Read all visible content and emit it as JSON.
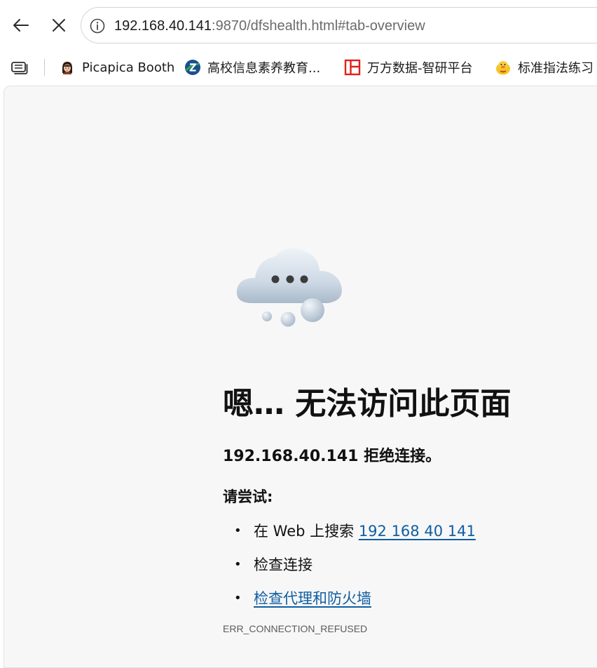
{
  "toolbar": {
    "back_icon": "back-arrow-icon",
    "stop_icon": "close-icon",
    "address": {
      "host": "192.168.40.141",
      "rest": ":9870/dfshealth.html#tab-overview",
      "info_icon": "info-icon"
    }
  },
  "bookmarks": {
    "collections_icon": "collections-icon",
    "items": [
      {
        "label": "Picapica Booth",
        "icon": "avatar-icon"
      },
      {
        "label": "高校信息素养教育...",
        "icon": "z-logo-icon"
      },
      {
        "label": "万方数据-智研平台",
        "icon": "wanfang-logo-icon"
      },
      {
        "label": "标准指法练习",
        "icon": "duck-icon"
      }
    ]
  },
  "error_page": {
    "illustration": "cloud-icon",
    "title": "嗯… 无法访问此页面",
    "subtitle": "192.168.40.141 拒绝连接。",
    "try_label": "请尝试:",
    "suggestions": [
      {
        "prefix": "在 Web 上搜索 ",
        "link": "192 168 40 141"
      },
      {
        "text": "检查连接"
      },
      {
        "link": "检查代理和防火墙"
      }
    ],
    "error_code": "ERR_CONNECTION_REFUSED"
  },
  "colors": {
    "link": "#0f5ea3",
    "page_background": "#f7f7f7",
    "text": "#111111"
  }
}
